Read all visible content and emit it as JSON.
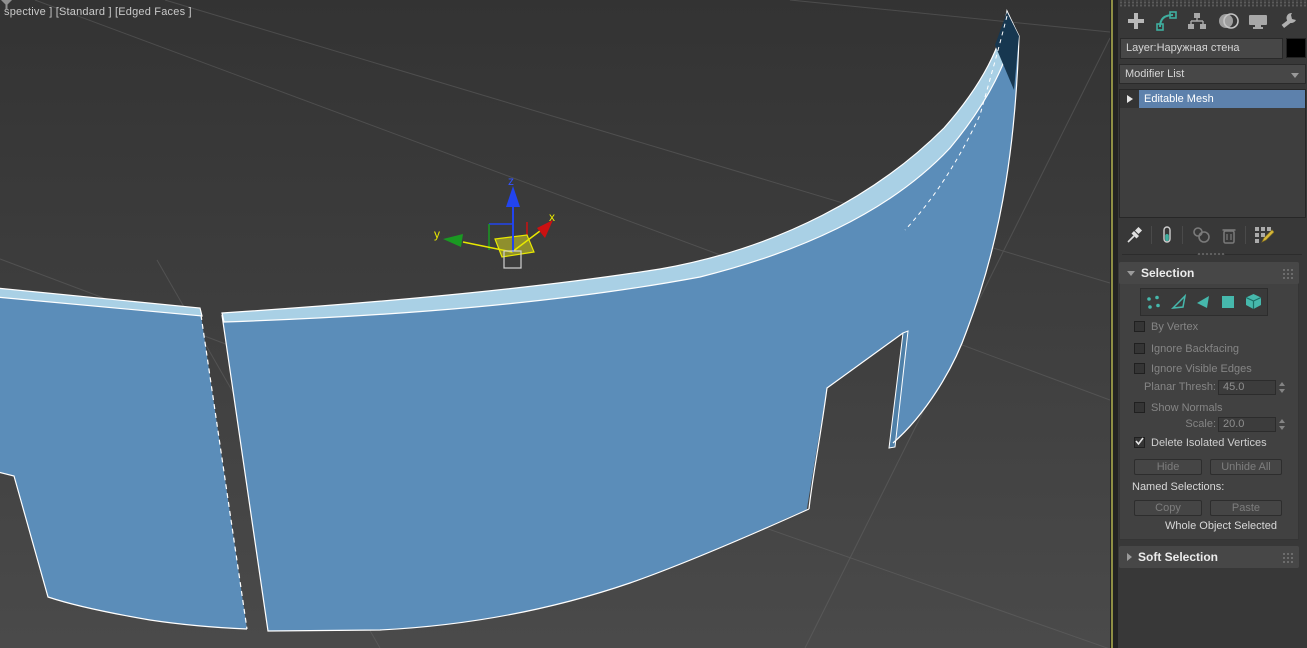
{
  "viewport": {
    "label": "spective ] [Standard ] [Edged Faces ]",
    "axis_labels": {
      "x": "x",
      "y": "y",
      "z": "z"
    },
    "colors": {
      "background_top": "#333333",
      "background_bottom": "#4a4a4a",
      "wall_face": "#5b8db9",
      "wall_top_band": "#a9d0e5",
      "wall_inner_dark": "#173750",
      "wall_sliver": "#4f80a8",
      "edge_highlight": "#ffffff",
      "grid_line": "#6b6b6b",
      "axis_x": "#cc1111",
      "axis_y": "#1a9922",
      "axis_z": "#2244ee",
      "gizmo_yellow": "#e8e800"
    }
  },
  "panel": {
    "tabs": [
      {
        "label": "create",
        "icon": "plus-icon",
        "active": false
      },
      {
        "label": "modify",
        "icon": "modify-icon",
        "active": true
      },
      {
        "label": "hierarchy",
        "icon": "hierarchy-icon",
        "active": false
      },
      {
        "label": "motion",
        "icon": "motion-icon",
        "active": false
      },
      {
        "label": "display",
        "icon": "display-icon",
        "active": false
      },
      {
        "label": "utilities",
        "icon": "wrench-icon",
        "active": false
      }
    ],
    "layer_field": {
      "value": "Layer:Наружная стена"
    },
    "object_color": "#000000",
    "modifier_dropdown": {
      "value": "Modifier List"
    },
    "modifier_stack": {
      "items": [
        {
          "label": "Editable Mesh",
          "selected": true
        }
      ]
    },
    "stack_tools": [
      "pin-stack",
      "show-end-result",
      "make-unique",
      "remove-modifier",
      "configure-modifier-sets"
    ],
    "selection_rollout": {
      "title": "Selection",
      "subobject_modes": [
        "vertex",
        "edge",
        "face",
        "polygon",
        "element"
      ],
      "accent_teal": "#46b8ac",
      "checkboxes": [
        {
          "label": "By Vertex",
          "checked": false,
          "enabled": false
        },
        {
          "label": "Ignore Backfacing",
          "checked": false,
          "enabled": false
        },
        {
          "label": "Ignore Visible Edges",
          "checked": false,
          "enabled": false
        },
        {
          "label": "Show Normals",
          "checked": false,
          "enabled": false
        },
        {
          "label": "Delete Isolated Vertices",
          "checked": true,
          "enabled": true
        }
      ],
      "spinners": [
        {
          "label": "Planar Thresh:",
          "value": "45.0"
        },
        {
          "label": "Scale:",
          "value": "20.0"
        }
      ],
      "buttons": {
        "hide": "Hide",
        "unhide_all": "Unhide All",
        "copy": "Copy",
        "paste": "Paste"
      },
      "named_selections_label": "Named Selections:",
      "status": "Whole Object Selected"
    },
    "soft_selection_rollout": {
      "title": "Soft Selection"
    },
    "stack_highlight_color": "#5d81ac"
  }
}
